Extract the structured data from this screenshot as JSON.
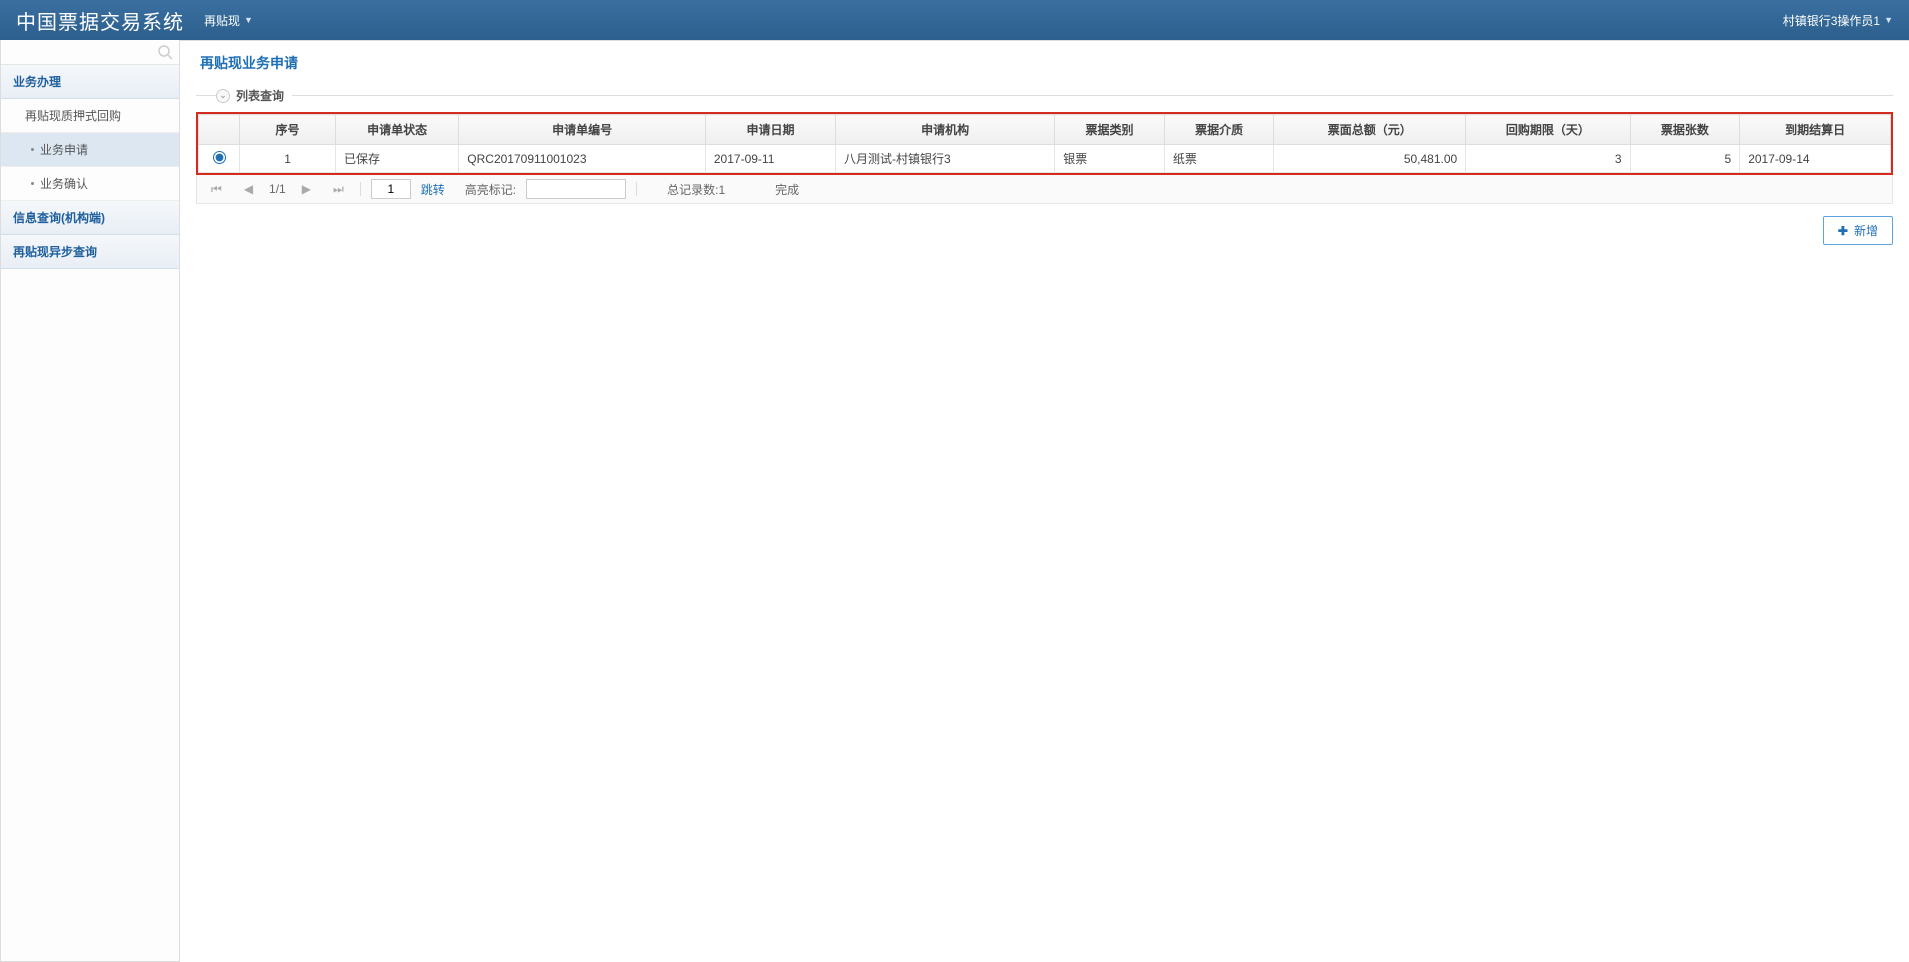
{
  "header": {
    "app_title": "中国票据交易系统",
    "nav_label": "再贴现",
    "user_label": "村镇银行3操作员1"
  },
  "sidebar": {
    "sections": [
      {
        "label": "业务办理",
        "type": "section"
      },
      {
        "label": "再贴现质押式回购",
        "type": "item"
      },
      {
        "label": "业务申请",
        "type": "subitem",
        "active": true
      },
      {
        "label": "业务确认",
        "type": "subitem",
        "active": false
      },
      {
        "label": "信息查询(机构端)",
        "type": "section"
      },
      {
        "label": "再贴现异步查询",
        "type": "section"
      }
    ]
  },
  "main": {
    "page_title": "再贴现业务申请",
    "panel_title": "列表查询",
    "table": {
      "headers": [
        "",
        "序号",
        "申请单状态",
        "申请单编号",
        "申请日期",
        "申请机构",
        "票据类别",
        "票据介质",
        "票面总额（元）",
        "回购期限（天）",
        "票据张数",
        "到期结算日"
      ],
      "rows": [
        {
          "selected": true,
          "seq": "1",
          "status": "已保存",
          "app_no": "QRC20170911001023",
          "app_date": "2017-09-11",
          "org": "八月测试-村镇银行3",
          "bill_type": "银票",
          "bill_medium": "纸票",
          "total_amount": "50,481.00",
          "repo_term": "3",
          "bill_count": "5",
          "settle_date": "2017-09-14"
        }
      ]
    },
    "pager": {
      "page_info": "1/1",
      "page_input": "1",
      "jump_label": "跳转",
      "highlight_label": "高亮标记:",
      "total_label": "总记录数:1",
      "status": "完成"
    },
    "actions": {
      "add_label": "新增"
    }
  }
}
